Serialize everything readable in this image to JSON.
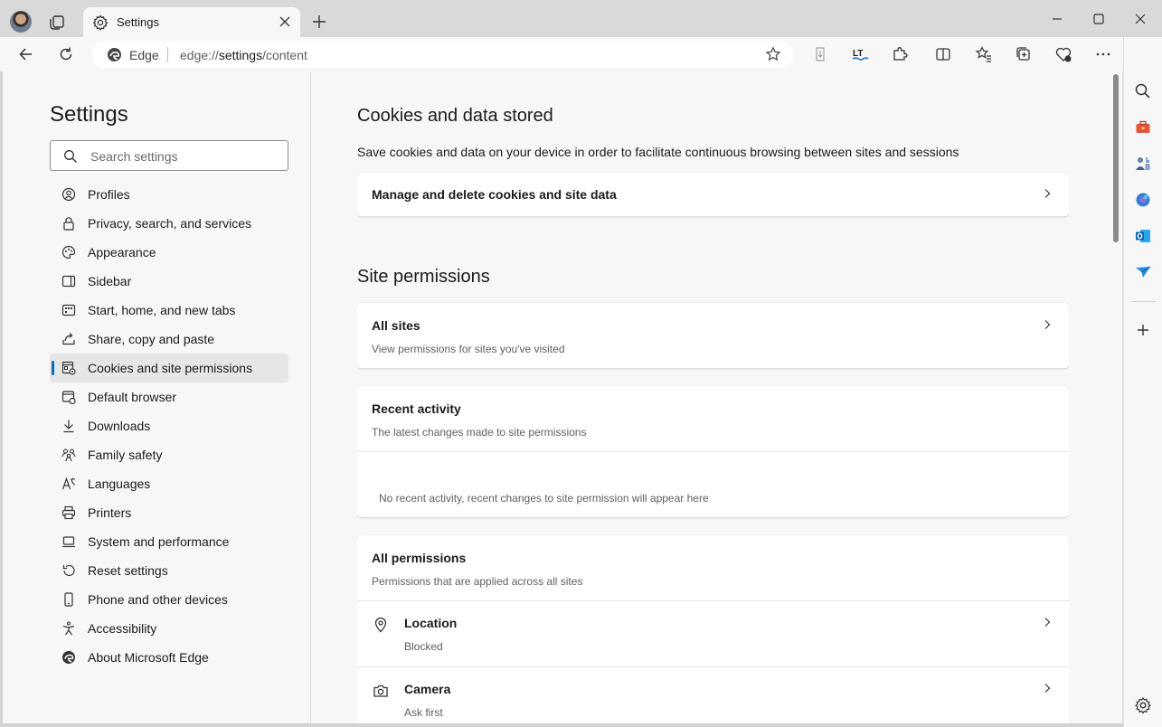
{
  "window": {
    "tab_title": "Settings",
    "tab_icon": "gear-icon",
    "controls": [
      "minimize",
      "maximize",
      "close"
    ]
  },
  "toolbar": {
    "address_brand": "Edge",
    "url_prefix": "edge://",
    "url_path": "settings",
    "url_rest": "/content",
    "icons": [
      "back-arrow-icon",
      "refresh-icon",
      "favorite-star-icon",
      "reader-icon",
      "lt-extension-icon",
      "extensions-puzzle-icon",
      "split-screen-icon",
      "favorites-icon",
      "collections-icon",
      "browser-essentials-icon",
      "more-dots-icon",
      "copilot-icon"
    ]
  },
  "nav": {
    "title": "Settings",
    "search_placeholder": "Search settings",
    "items": [
      {
        "label": "Profiles",
        "icon": "profile-icon"
      },
      {
        "label": "Privacy, search, and services",
        "icon": "lock-icon"
      },
      {
        "label": "Appearance",
        "icon": "palette-icon"
      },
      {
        "label": "Sidebar",
        "icon": "sidebar-icon"
      },
      {
        "label": "Start, home, and new tabs",
        "icon": "grid-icon"
      },
      {
        "label": "Share, copy and paste",
        "icon": "share-icon"
      },
      {
        "label": "Cookies and site permissions",
        "icon": "cookies-icon",
        "active": true
      },
      {
        "label": "Default browser",
        "icon": "browser-icon"
      },
      {
        "label": "Downloads",
        "icon": "download-icon"
      },
      {
        "label": "Family safety",
        "icon": "family-icon"
      },
      {
        "label": "Languages",
        "icon": "language-icon"
      },
      {
        "label": "Printers",
        "icon": "printer-icon"
      },
      {
        "label": "System and performance",
        "icon": "laptop-icon"
      },
      {
        "label": "Reset settings",
        "icon": "reset-icon"
      },
      {
        "label": "Phone and other devices",
        "icon": "phone-icon"
      },
      {
        "label": "Accessibility",
        "icon": "accessibility-icon"
      },
      {
        "label": "About Microsoft Edge",
        "icon": "edge-logo-icon"
      }
    ]
  },
  "content": {
    "cookies_heading": "Cookies and data stored",
    "cookies_desc": "Save cookies and data on your device in order to facilitate continuous browsing between sites and sessions",
    "manage_cookies": "Manage and delete cookies and site data",
    "site_permissions_heading": "Site permissions",
    "all_sites": {
      "title": "All sites",
      "subtitle": "View permissions for sites you've visited"
    },
    "recent_activity": {
      "title": "Recent activity",
      "subtitle": "The latest changes made to site permissions",
      "empty": "No recent activity, recent changes to site permission will appear here"
    },
    "all_permissions": {
      "title": "All permissions",
      "subtitle": "Permissions that are applied across all sites"
    },
    "permissions": [
      {
        "title": "Location",
        "status": "Blocked",
        "icon": "location-pin-icon"
      },
      {
        "title": "Camera",
        "status": "Ask first",
        "icon": "camera-icon"
      }
    ]
  },
  "right_sidebar": {
    "icons": [
      "search-icon",
      "tools-briefcase-icon",
      "games-icon",
      "copilot-app-icon",
      "outlook-icon",
      "send-icon",
      "add-icon",
      "settings-gear-icon"
    ]
  },
  "colors": {
    "accent": "#0f6cbd",
    "page_bg": "#f7f7f7",
    "titlebar_bg": "#d9d9d9"
  }
}
